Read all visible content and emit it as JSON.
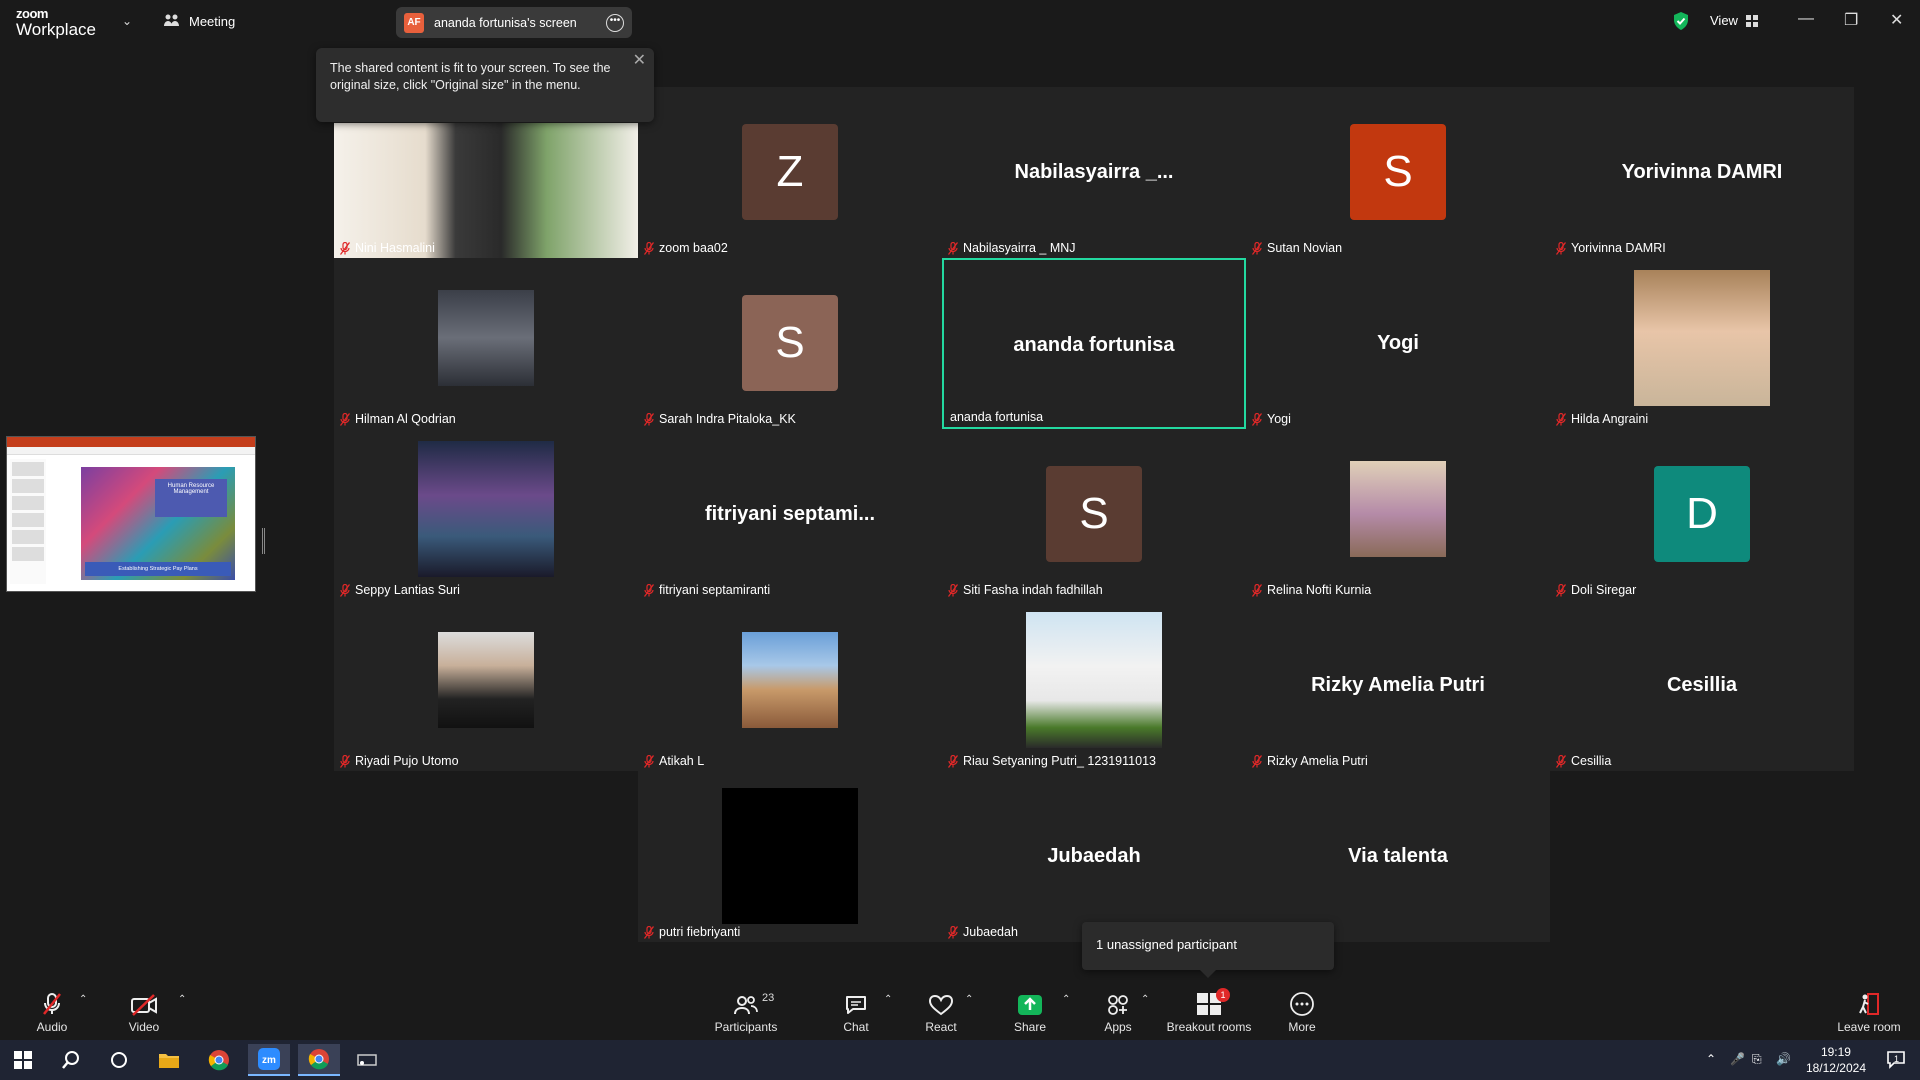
{
  "app": {
    "brand_top": "zoom",
    "brand_bottom": "Workplace",
    "meeting_label": "Meeting"
  },
  "share": {
    "badge": "AF",
    "title": "ananda fortunisa's screen"
  },
  "header": {
    "view_label": "View"
  },
  "tooltip": {
    "text": "The shared content is fit to your screen. To see the original size, click \"Original size\" in the menu."
  },
  "slide": {
    "title": "Human Resource Management",
    "subtitle": "Establishing Strategic Pay Plans"
  },
  "participants": [
    {
      "name": "Nini Hasmalini",
      "display": "",
      "avatar_letter": "",
      "avatar_color": "",
      "type": "video"
    },
    {
      "name": "zoom baa02",
      "display": "",
      "avatar_letter": "Z",
      "avatar_color": "#5a3c32",
      "type": "avatar"
    },
    {
      "name": "Nabilasyairra _ MNJ",
      "display": "Nabilasyairra _...",
      "avatar_letter": "",
      "avatar_color": "",
      "type": "text"
    },
    {
      "name": "Sutan Novian",
      "display": "",
      "avatar_letter": "S",
      "avatar_color": "#c2380f",
      "type": "avatar"
    },
    {
      "name": "Yorivinna DAMRI",
      "display": "Yorivinna DAMRI",
      "avatar_letter": "",
      "avatar_color": "",
      "type": "text"
    },
    {
      "name": "Hilman Al Qodrian",
      "display": "",
      "avatar_letter": "",
      "avatar_color": "",
      "type": "photo"
    },
    {
      "name": "Sarah Indra Pitaloka_KK",
      "display": "",
      "avatar_letter": "S",
      "avatar_color": "#8b6456",
      "type": "avatar"
    },
    {
      "name": "ananda fortunisa",
      "display": "ananda fortunisa",
      "avatar_letter": "",
      "avatar_color": "",
      "type": "text"
    },
    {
      "name": "Yogi",
      "display": "Yogi",
      "avatar_letter": "",
      "avatar_color": "",
      "type": "text"
    },
    {
      "name": "Hilda Angraini",
      "display": "",
      "avatar_letter": "",
      "avatar_color": "",
      "type": "photo"
    },
    {
      "name": "Seppy Lantias Suri",
      "display": "",
      "avatar_letter": "",
      "avatar_color": "",
      "type": "photo"
    },
    {
      "name": "fitriyani septamiranti",
      "display": "fitriyani septami...",
      "avatar_letter": "",
      "avatar_color": "",
      "type": "text"
    },
    {
      "name": "Siti Fasha indah fadhillah",
      "display": "",
      "avatar_letter": "S",
      "avatar_color": "#5a3c32",
      "type": "avatar"
    },
    {
      "name": "Relina Nofti Kurnia",
      "display": "",
      "avatar_letter": "",
      "avatar_color": "",
      "type": "photo"
    },
    {
      "name": "Doli Siregar",
      "display": "",
      "avatar_letter": "D",
      "avatar_color": "#0e8a7c",
      "type": "avatar"
    },
    {
      "name": "Riyadi Pujo Utomo",
      "display": "",
      "avatar_letter": "",
      "avatar_color": "",
      "type": "photo"
    },
    {
      "name": "Atikah L",
      "display": "",
      "avatar_letter": "",
      "avatar_color": "",
      "type": "photo"
    },
    {
      "name": "Riau Setyaning Putri_ 1231911013",
      "display": "",
      "avatar_letter": "",
      "avatar_color": "",
      "type": "photo"
    },
    {
      "name": "Rizky Amelia Putri",
      "display": "Rizky Amelia Putri",
      "avatar_letter": "",
      "avatar_color": "",
      "type": "text"
    },
    {
      "name": "Cesillia",
      "display": "Cesillia",
      "avatar_letter": "",
      "avatar_color": "",
      "type": "text"
    },
    {
      "name": "putri fiebriyanti",
      "display": "",
      "avatar_letter": "",
      "avatar_color": "",
      "type": "black"
    },
    {
      "name": "Jubaedah",
      "display": "Jubaedah",
      "avatar_letter": "",
      "avatar_color": "",
      "type": "text"
    },
    {
      "name": "",
      "display": "Via talenta",
      "avatar_letter": "",
      "avatar_color": "",
      "type": "text"
    }
  ],
  "unassigned": {
    "text": "1 unassigned participant"
  },
  "toolbar": {
    "audio": "Audio",
    "video": "Video",
    "participants": "Participants",
    "participants_count": "23",
    "chat": "Chat",
    "react": "React",
    "share": "Share",
    "apps": "Apps",
    "breakout": "Breakout rooms",
    "breakout_badge": "1",
    "more": "More",
    "leave": "Leave room"
  },
  "taskbar": {
    "time": "19:19",
    "date": "18/12/2024",
    "notif_count": "1"
  },
  "colors": {
    "speaking_border": "#23d9a0",
    "share_green": "#13b65a",
    "recording_red": "#e02828"
  }
}
